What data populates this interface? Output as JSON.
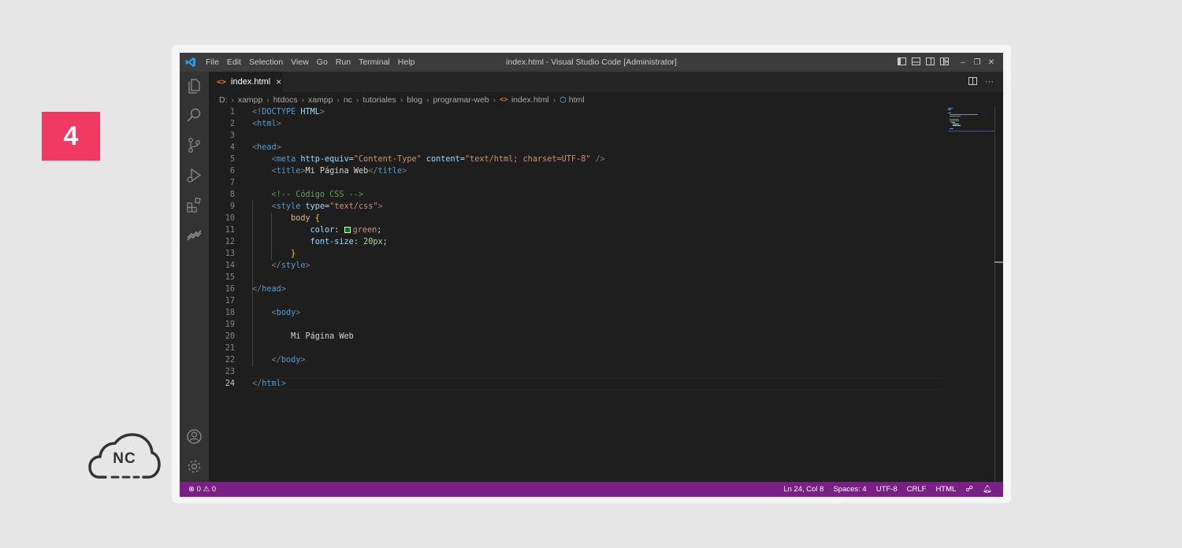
{
  "badge": {
    "number": "4"
  },
  "logo": {
    "text": "NC"
  },
  "window": {
    "title": "index.html - Visual Studio Code [Administrator]",
    "menu": [
      "File",
      "Edit",
      "Selection",
      "View",
      "Go",
      "Run",
      "Terminal",
      "Help"
    ],
    "controls": [
      "layout-sidebar-icon",
      "layout-panel-icon",
      "layout-sidebar-right-icon",
      "layout-customize-icon",
      "minimize-icon",
      "restore-icon",
      "close-icon"
    ]
  },
  "activity_bar": [
    "explorer-icon",
    "search-icon",
    "source-control-icon",
    "run-debug-icon",
    "extensions-icon",
    "remote-icon",
    "account-icon",
    "settings-gear-icon"
  ],
  "tab": {
    "label": "index.html",
    "close": "×"
  },
  "breadcrumb": {
    "parts": [
      "D:",
      "xampp",
      "htdocs",
      "xampp",
      "nc",
      "tutoriales",
      "blog",
      "programar-web"
    ],
    "file": "index.html",
    "symbol": "html"
  },
  "editor": {
    "active_line": 24,
    "lines": [
      {
        "n": "1"
      },
      {
        "n": "2"
      },
      {
        "n": "3"
      },
      {
        "n": "4"
      },
      {
        "n": "5"
      },
      {
        "n": "6"
      },
      {
        "n": "7"
      },
      {
        "n": "8"
      },
      {
        "n": "9"
      },
      {
        "n": "10"
      },
      {
        "n": "11"
      },
      {
        "n": "12"
      },
      {
        "n": "13"
      },
      {
        "n": "14"
      },
      {
        "n": "15"
      },
      {
        "n": "16"
      },
      {
        "n": "17"
      },
      {
        "n": "18"
      },
      {
        "n": "19"
      },
      {
        "n": "20"
      },
      {
        "n": "21"
      },
      {
        "n": "22"
      },
      {
        "n": "23"
      },
      {
        "n": "24"
      }
    ],
    "tokens": {
      "doctype": "DOCTYPE",
      "doctype_html": "HTML",
      "html": "html",
      "head": "head",
      "meta": "meta",
      "http_equiv_attr": "http-equiv",
      "http_equiv_val": "\"Content-Type\"",
      "content_attr": "content",
      "content_val": "\"text/html; charset=UTF-8\"",
      "title": "title",
      "title_text": "Mi Página Web",
      "comment": "<!-- Código CSS -->",
      "style": "style",
      "type_attr": "type",
      "type_val": "\"text/css\"",
      "selector": "body",
      "prop_color": "color",
      "val_color": "green",
      "prop_font_size": "font-size",
      "val_font_size": "20px",
      "body": "body",
      "body_text": "Mi Página Web"
    }
  },
  "status_bar": {
    "errors": "0",
    "warnings": "0",
    "position": "Ln 24, Col 8",
    "spaces": "Spaces: 4",
    "encoding": "UTF-8",
    "eol": "CRLF",
    "language": "HTML"
  },
  "colors": {
    "status_bar": "#7a1f86",
    "badge": "#f13a63",
    "editor_bg": "#1e1e1e",
    "swatch_green": "#008000"
  }
}
